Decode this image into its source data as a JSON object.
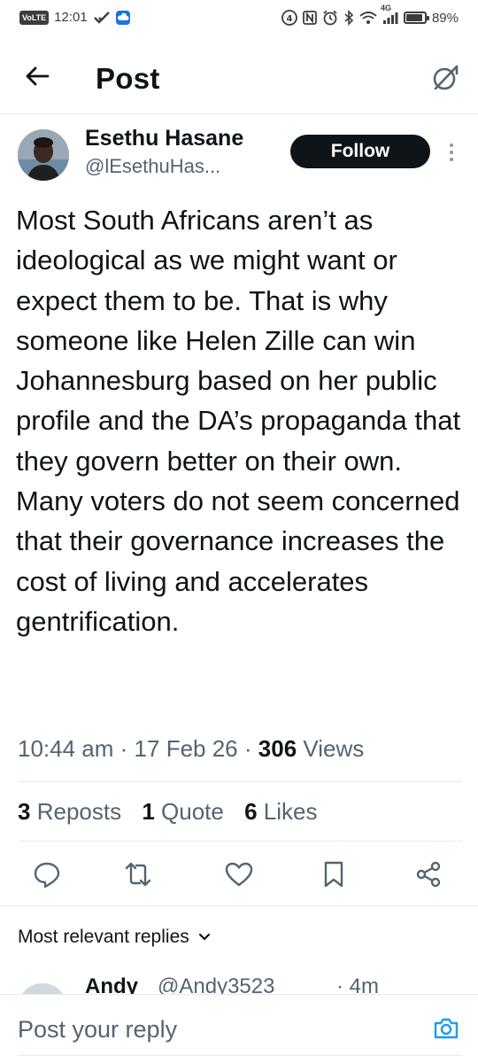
{
  "status_bar": {
    "volte": "VoLTE",
    "time": "12:01",
    "network": "4G",
    "battery_text": "89%",
    "battery_level": 0.89
  },
  "header": {
    "title": "Post"
  },
  "author": {
    "name": "Esethu Hasane",
    "handle": "@lEsethuHas..."
  },
  "follow_label": "Follow",
  "post": {
    "text": "Most South Africans aren’t as ideological as we might want or expect them to be. That is why someone like Helen Zille can win Johannesburg based on her public profile and the DA’s propaganda that they govern better on their own. Many voters do not seem concerned that their governance increases the cost of living and accelerates gentrification.",
    "time": "10:44 am",
    "date": "17 Feb 26",
    "views_count": "306",
    "views_label": "Views",
    "dot": "·"
  },
  "stats": {
    "reposts_count": "3",
    "reposts_label": "Reposts",
    "quotes_count": "1",
    "quotes_label": "Quote",
    "likes_count": "6",
    "likes_label": "Likes"
  },
  "replies": {
    "sort_label": "Most relevant replies",
    "first_reply": {
      "name": "Andy",
      "handle": "@Andy3523",
      "time": "· 4m"
    }
  },
  "composer": {
    "placeholder": "Post your reply"
  },
  "colors": {
    "text": "#0f1419",
    "secondary": "#536471",
    "divider": "#e6e9eb",
    "accent": "#1d9bf0"
  }
}
